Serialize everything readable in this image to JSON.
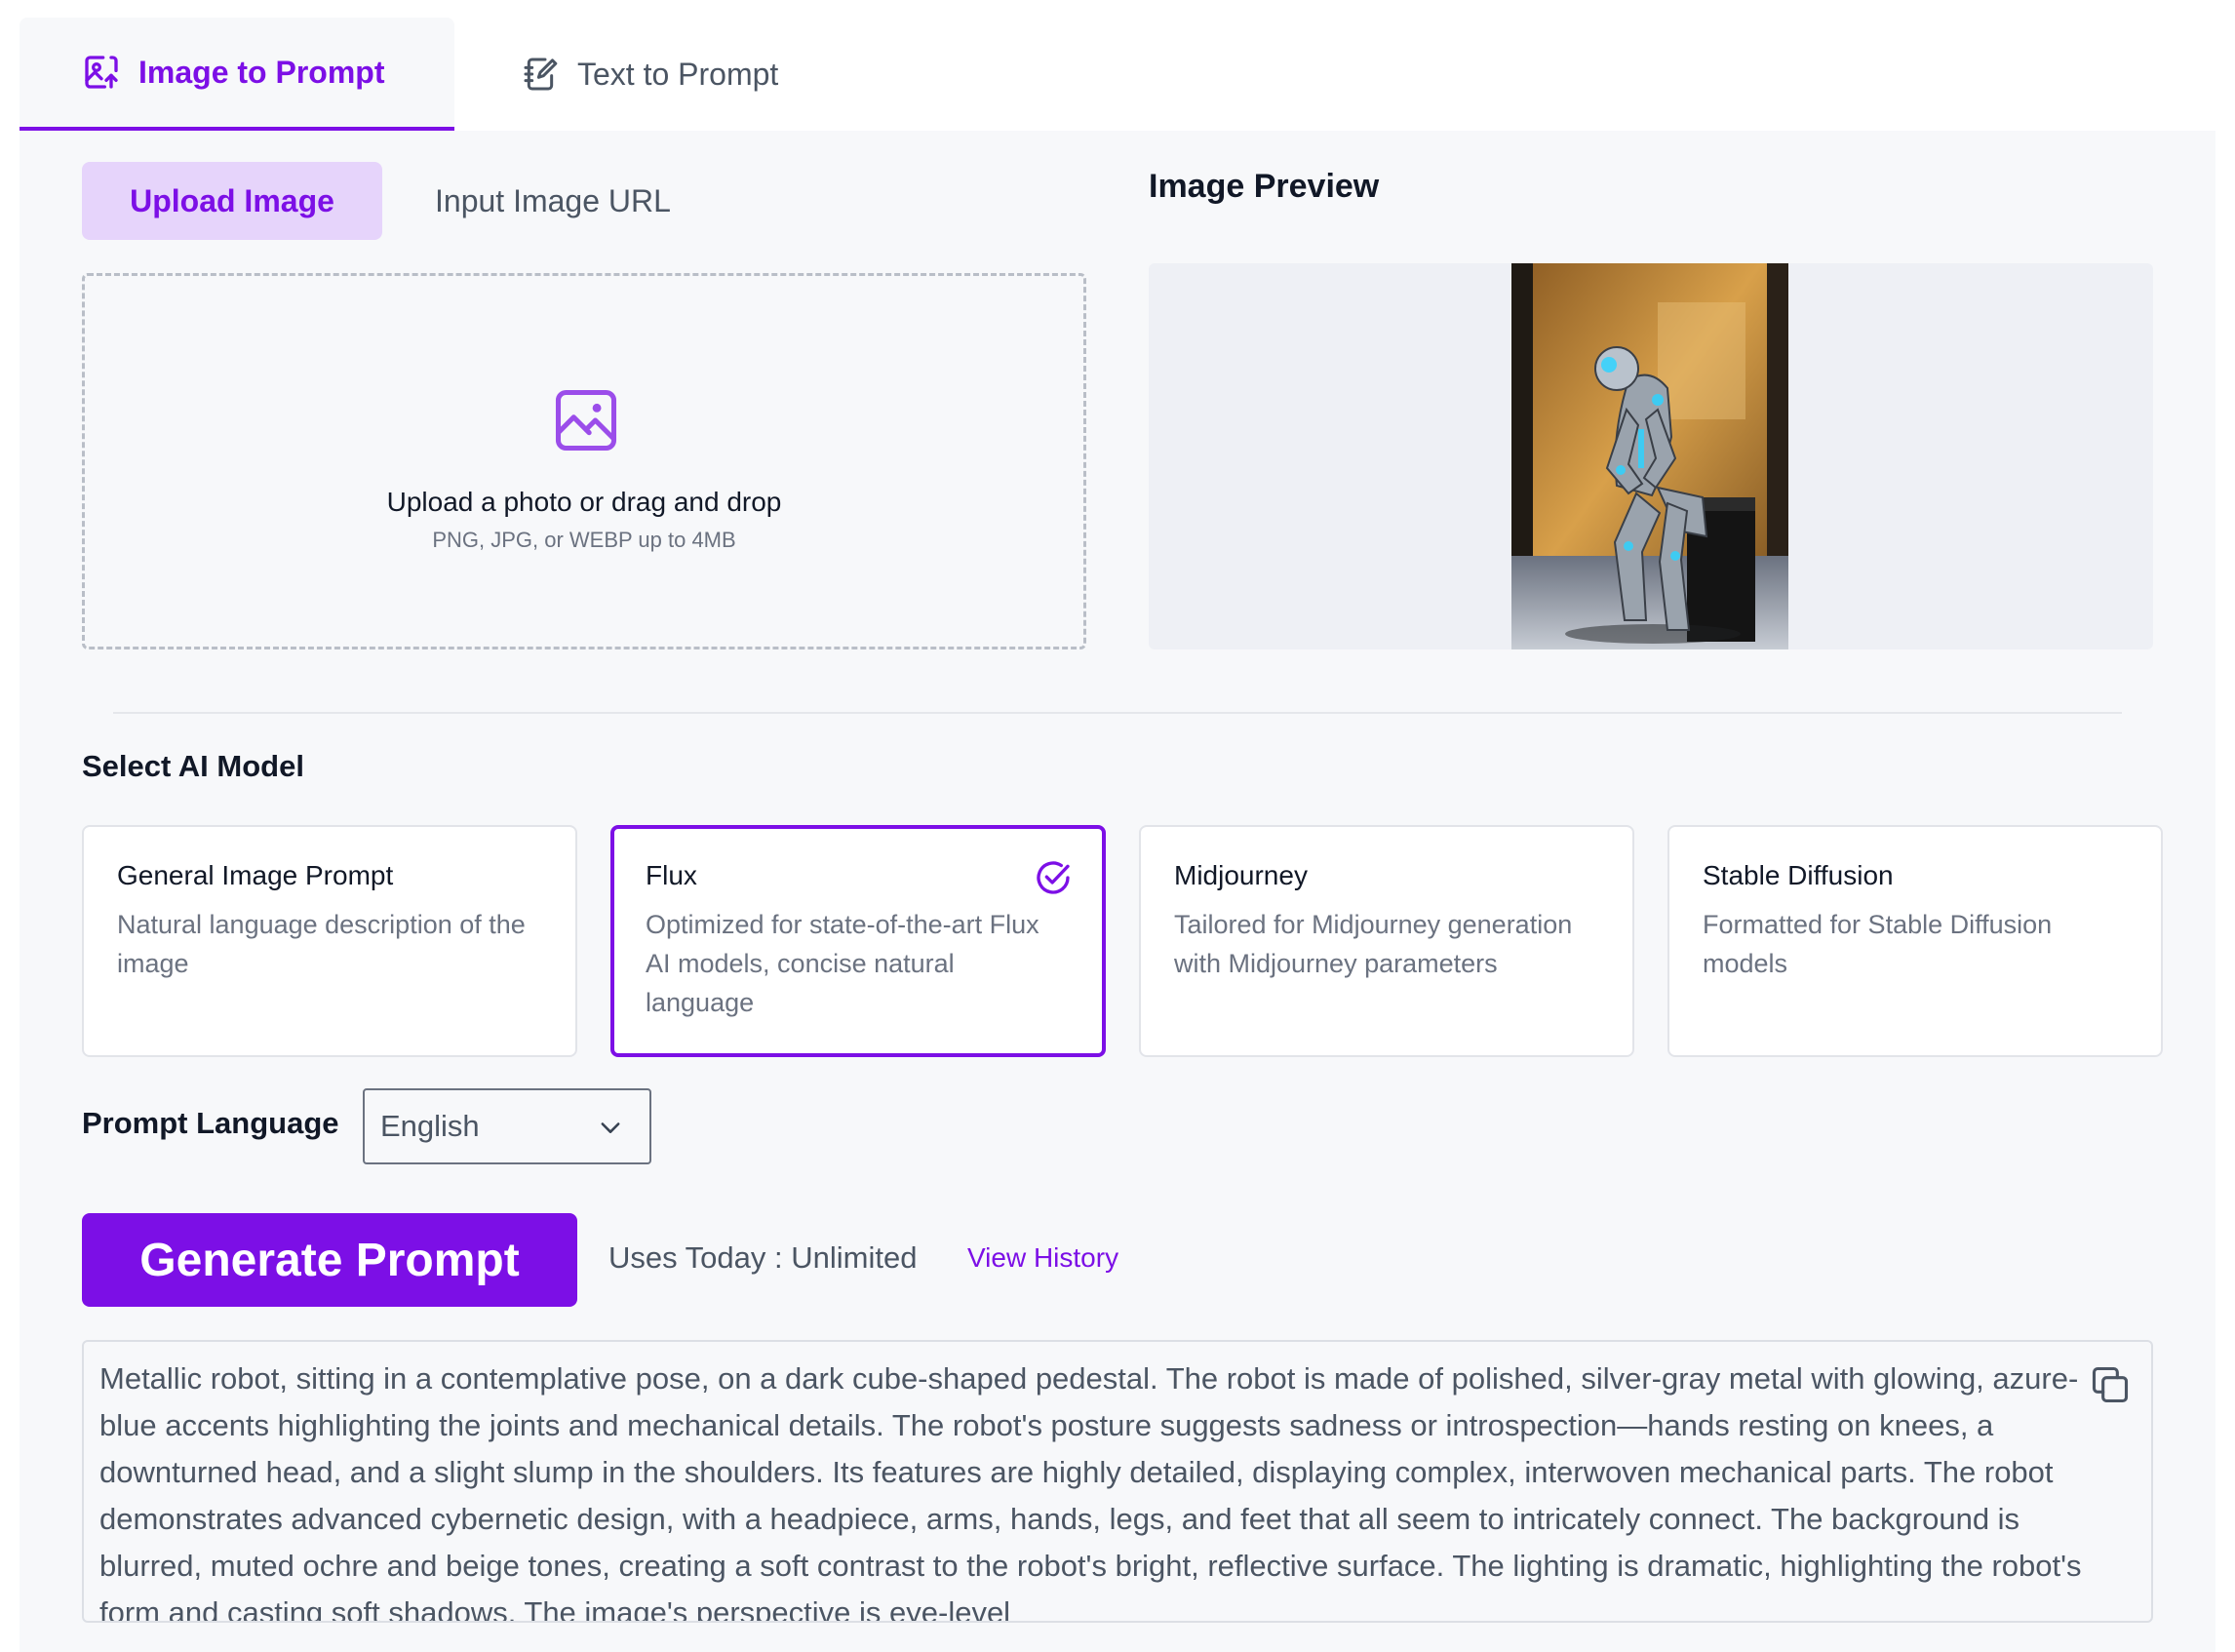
{
  "tabs": [
    {
      "label": "Image to Prompt",
      "icon": "image-upload-icon",
      "active": true
    },
    {
      "label": "Text to Prompt",
      "icon": "notebook-edit-icon",
      "active": false
    }
  ],
  "source_tabs": {
    "upload_label": "Upload Image",
    "url_label": "Input Image URL"
  },
  "dropzone": {
    "icon": "image-icon",
    "title": "Upload a photo or drag and drop",
    "subtitle": "PNG, JPG, or WEBP up to 4MB"
  },
  "preview": {
    "title": "Image Preview"
  },
  "model_section": {
    "title": "Select AI Model",
    "models": [
      {
        "name": "General Image Prompt",
        "description": "Natural language description of the image",
        "selected": false
      },
      {
        "name": "Flux",
        "description": "Optimized for state-of-the-art Flux AI models, concise natural language",
        "selected": true
      },
      {
        "name": "Midjourney",
        "description": "Tailored for Midjourney generation with Midjourney parameters",
        "selected": false
      },
      {
        "name": "Stable Diffusion",
        "description": "Formatted for Stable Diffusion models",
        "selected": false
      }
    ]
  },
  "language": {
    "label": "Prompt Language",
    "selected": "English"
  },
  "actions": {
    "generate_label": "Generate Prompt",
    "uses_text": "Uses Today : Unlimited",
    "history_label": "View History"
  },
  "output": {
    "text": "Metallic robot, sitting in a contemplative pose,  on a dark cube-shaped pedestal.  The robot is made of polished, silver-gray metal with glowing, azure-blue accents highlighting the joints and mechanical details.  The robot's posture suggests sadness or introspection—hands resting on knees, a downturned head, and a slight slump in the shoulders.  Its features are highly detailed, displaying complex, interwoven mechanical parts.  The robot demonstrates advanced cybernetic design, with a headpiece, arms, hands, legs, and feet that all seem to intricately connect.  The background is blurred, muted ochre and beige tones, creating a soft contrast to the robot's bright, reflective surface.  The lighting is dramatic, highlighting the robot's form and casting soft shadows. The image's perspective is eye-level"
  },
  "colors": {
    "accent": "#7c0fe6",
    "accent_light": "#e6d4fb",
    "panel_bg": "#f7f8fa"
  }
}
